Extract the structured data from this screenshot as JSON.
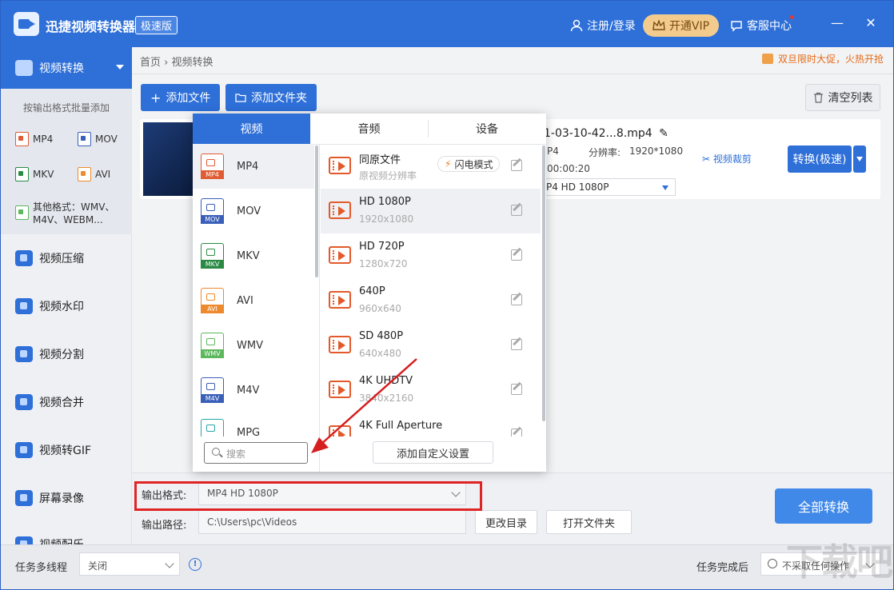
{
  "app": {
    "title": "迅捷视频转换器",
    "edition": "极速版"
  },
  "titlebar": {
    "login": "注册/登录",
    "vip": "开通VIP",
    "service": "客服中心",
    "minimize": "—",
    "close": "✕"
  },
  "sidebar": {
    "active": "视频转换",
    "batch_hint": "按输出格式批量添加",
    "formats": [
      {
        "label": "MP4",
        "color": "#e05c33"
      },
      {
        "label": "MOV",
        "color": "#3a5fb8"
      },
      {
        "label": "MKV",
        "color": "#2a8a44"
      },
      {
        "label": "AVI",
        "color": "#ee8a2e"
      },
      {
        "label": "其他格式：WMV、M4V、WEBM...",
        "color": "#5cb85c"
      }
    ],
    "items": [
      "视频压缩",
      "视频水印",
      "视频分割",
      "视频合并",
      "视频转GIF",
      "屏幕录像",
      "视频配乐"
    ]
  },
  "breadcrumb": {
    "home": "首页",
    "sep": "›",
    "current": "视频转换"
  },
  "promo": "双旦限时大促，火热开抢",
  "toolbar": {
    "add_file": "添加文件",
    "add_folder": "添加文件夹",
    "clear": "清空列表"
  },
  "file": {
    "name": "1-03-10-42...8.mp4",
    "format": "P4",
    "resolution_label": "分辨率:",
    "resolution": "1920*1080",
    "duration": "00:00:20",
    "output": "P4  HD 1080P",
    "clip": "视频裁剪",
    "convert": "转换(极速)"
  },
  "popup": {
    "tabs": [
      "视频",
      "音频",
      "设备"
    ],
    "formats": [
      {
        "label": "MP4",
        "color": "#e05c33"
      },
      {
        "label": "MOV",
        "color": "#3a5fb8"
      },
      {
        "label": "MKV",
        "color": "#2a8a44"
      },
      {
        "label": "AVI",
        "color": "#ee8a2e"
      },
      {
        "label": "WMV",
        "color": "#5cb85c"
      },
      {
        "label": "M4V",
        "color": "#3a5fb8"
      },
      {
        "label": "MPG",
        "color": "#2aa6a6"
      }
    ],
    "resolutions": [
      {
        "name": "同原文件",
        "sub": "原视频分辨率"
      },
      {
        "name": "HD 1080P",
        "sub": "1920x1080"
      },
      {
        "name": "HD 720P",
        "sub": "1280x720"
      },
      {
        "name": "640P",
        "sub": "960x640"
      },
      {
        "name": "SD 480P",
        "sub": "640x480"
      },
      {
        "name": "4K UHDTV",
        "sub": "3840x2160"
      },
      {
        "name": "4K Full Aperture",
        "sub": ""
      }
    ],
    "flash_mode": "闪电模式",
    "search_placeholder": "搜索",
    "add_custom": "添加自定义设置"
  },
  "output": {
    "format_label": "输出格式:",
    "format_value": "MP4  HD 1080P",
    "path_label": "输出路径:",
    "path_value": "C:\\Users\\pc\\Videos",
    "change_dir": "更改目录",
    "open_folder": "打开文件夹",
    "convert_all": "全部转换"
  },
  "status": {
    "multithread": "任务多线程",
    "multithread_value": "关闭",
    "after": "任务完成后",
    "after_value": "不采取任何操作"
  },
  "watermark": "下载吧"
}
